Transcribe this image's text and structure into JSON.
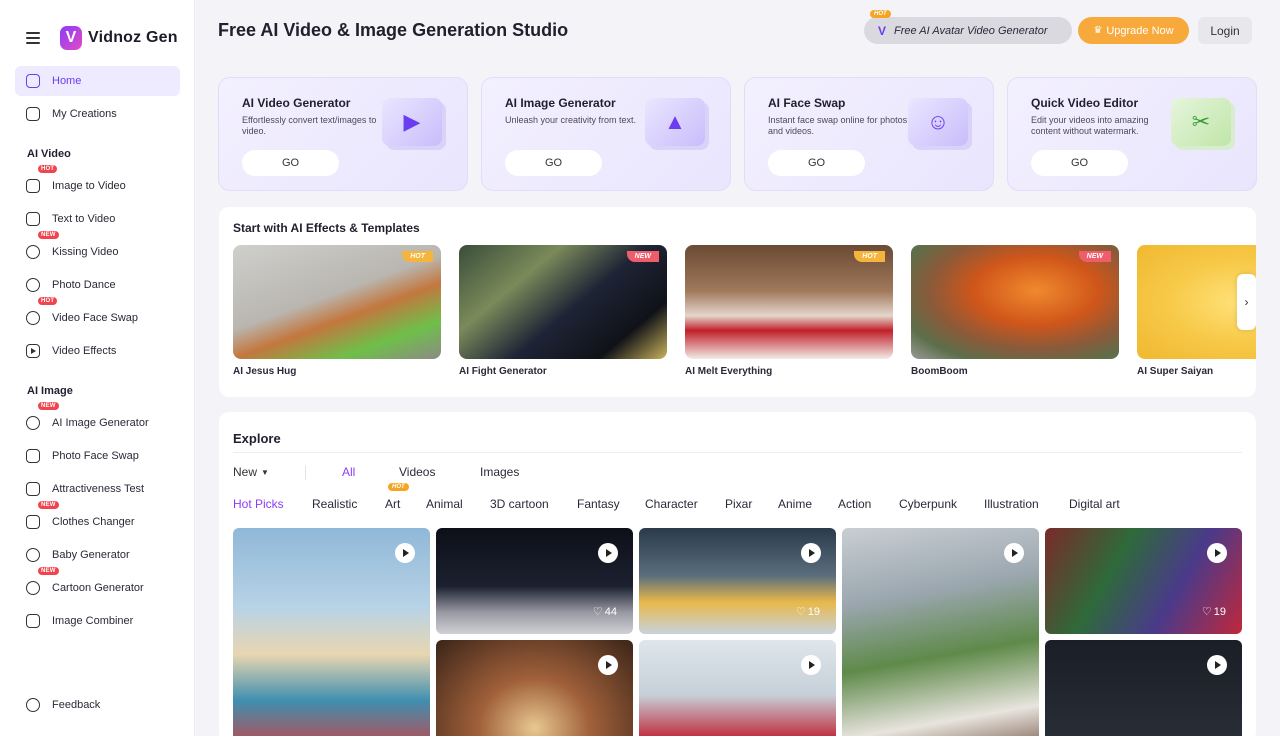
{
  "brand": {
    "logo_letter": "V",
    "name": "Vidnoz Gen"
  },
  "sidebar": {
    "items": [
      {
        "label": "Home",
        "icon": "home-icon"
      },
      {
        "label": "My Creations",
        "icon": "archive-icon"
      }
    ],
    "sections": [
      {
        "title": "AI Video",
        "items": [
          {
            "label": "Image to Video",
            "badge": "HOT"
          },
          {
            "label": "Text to Video",
            "badge": ""
          },
          {
            "label": "Kissing Video",
            "badge": "NEW"
          },
          {
            "label": "Photo Dance",
            "badge": ""
          },
          {
            "label": "Video Face Swap",
            "badge": "HOT"
          },
          {
            "label": "Video Effects",
            "badge": ""
          }
        ]
      },
      {
        "title": "AI Image",
        "items": [
          {
            "label": "AI Image Generator",
            "badge": "NEW"
          },
          {
            "label": "Photo Face Swap",
            "badge": ""
          },
          {
            "label": "Attractiveness Test",
            "badge": ""
          },
          {
            "label": "Clothes Changer",
            "badge": "NEW"
          },
          {
            "label": "Baby Generator",
            "badge": ""
          },
          {
            "label": "Cartoon Generator",
            "badge": "NEW"
          },
          {
            "label": "Image Combiner",
            "badge": ""
          }
        ]
      }
    ],
    "feedback": "Feedback"
  },
  "header": {
    "title": "Free AI Video & Image Generation Studio",
    "avatar_pill": {
      "badge": "HOT",
      "label": "Free AI Avatar Video Generator"
    },
    "upgrade": "Upgrade Now",
    "login": "Login"
  },
  "tools": [
    {
      "title": "AI Video Generator",
      "desc": "Effortlessly convert text/images to video.",
      "go": "GO"
    },
    {
      "title": "AI Image Generator",
      "desc": "Unleash your creativity from text.",
      "go": "GO"
    },
    {
      "title": "AI Face Swap",
      "desc": "Instant face swap online for photos and videos.",
      "go": "GO"
    },
    {
      "title": "Quick Video Editor",
      "desc": "Edit your videos into amazing content without watermark.",
      "go": "GO"
    }
  ],
  "effects": {
    "title": "Start with AI Effects & Templates",
    "items": [
      {
        "label": "AI Jesus Hug",
        "tag": "HOT"
      },
      {
        "label": "AI Fight Generator",
        "tag": "NEW"
      },
      {
        "label": "AI Melt Everything",
        "tag": "HOT"
      },
      {
        "label": "BoomBoom",
        "tag": "NEW"
      },
      {
        "label": "AI Super Saiyan",
        "tag": ""
      }
    ]
  },
  "explore": {
    "title": "Explore",
    "sort": "New",
    "types": [
      "All",
      "Videos",
      "Images"
    ],
    "categories": [
      "Hot Picks",
      "Realistic",
      "Art",
      "Animal",
      "3D cartoon",
      "Fantasy",
      "Character",
      "Pixar",
      "Anime",
      "Action",
      "Cyberpunk",
      "Illustration",
      "Digital art"
    ],
    "art_badge": "HOT",
    "likes": [
      "44",
      "19",
      "19"
    ]
  },
  "colors": {
    "accent": "#8b3cf7",
    "upgrade": "#f7a93b",
    "hot": "#f5a524",
    "new": "#ef5d6a"
  }
}
